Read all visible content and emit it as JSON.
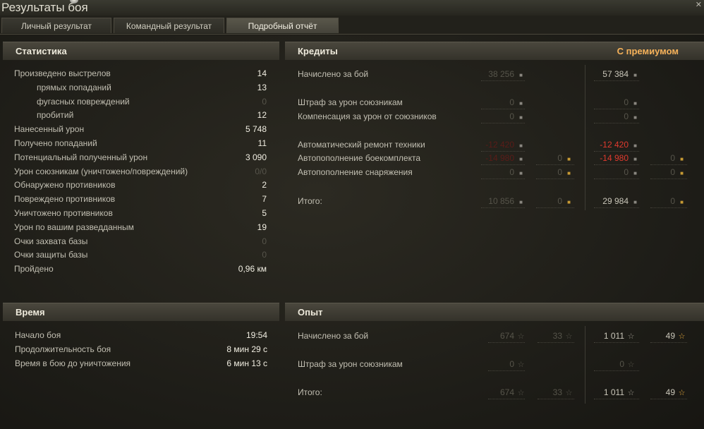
{
  "window": {
    "title": "Результаты боя",
    "close_glyph": "✕"
  },
  "tabs": [
    {
      "label": "Личный результат",
      "active": false
    },
    {
      "label": "Командный результат",
      "active": false
    },
    {
      "label": "Подробный отчёт",
      "active": true
    }
  ],
  "statistics": {
    "title": "Статистика",
    "rows": [
      {
        "label": "Произведено выстрелов",
        "value": "14",
        "sub": false,
        "dim": false
      },
      {
        "label": "прямых попаданий",
        "value": "13",
        "sub": true,
        "dim": false
      },
      {
        "label": "фугасных повреждений",
        "value": "0",
        "sub": true,
        "dim": true
      },
      {
        "label": "пробитий",
        "value": "12",
        "sub": true,
        "dim": false
      },
      {
        "label": "Нанесенный урон",
        "value": "5 748",
        "sub": false,
        "dim": false
      },
      {
        "label": "Получено попаданий",
        "value": "11",
        "sub": false,
        "dim": false
      },
      {
        "label": "Потенциальный полученный урон",
        "value": "3 090",
        "sub": false,
        "dim": false
      },
      {
        "label": "Урон союзникам (уничтожено/повреждений)",
        "value": "0/0",
        "sub": false,
        "dim": true
      },
      {
        "label": "Обнаружено противников",
        "value": "2",
        "sub": false,
        "dim": false
      },
      {
        "label": "Повреждено противников",
        "value": "7",
        "sub": false,
        "dim": false
      },
      {
        "label": "Уничтожено противников",
        "value": "5",
        "sub": false,
        "dim": false
      },
      {
        "label": "Урон по вашим разведданным",
        "value": "19",
        "sub": false,
        "dim": false
      },
      {
        "label": "Очки захвата базы",
        "value": "0",
        "sub": false,
        "dim": true
      },
      {
        "label": "Очки защиты базы",
        "value": "0",
        "sub": false,
        "dim": true
      },
      {
        "label": "Пройдено",
        "value": "0,96 км",
        "sub": false,
        "dim": false
      }
    ]
  },
  "credits": {
    "title": "Кредиты",
    "premium_label": "С премиумом",
    "rows": [
      {
        "label": "Начислено за бой",
        "base": "38 256",
        "base_gold": null,
        "prem": "57 384",
        "prem_gold": null,
        "base_red": false,
        "prem_red": false,
        "prem_dim": false
      },
      {
        "label": "Штраф за урон союзникам",
        "base": "0",
        "base_gold": null,
        "prem": "0",
        "prem_gold": null,
        "base_red": false,
        "prem_red": false,
        "prem_dim": true
      },
      {
        "label": "Компенсация за урон от союзников",
        "base": "0",
        "base_gold": null,
        "prem": "0",
        "prem_gold": null,
        "base_red": false,
        "prem_red": false,
        "prem_dim": true
      },
      {
        "label": "Автоматический ремонт техники",
        "base": "-12 420",
        "base_gold": null,
        "prem": "-12 420",
        "prem_gold": null,
        "base_red": true,
        "prem_red": true,
        "prem_dim": false
      },
      {
        "label": "Автопополнение боекомплекта",
        "base": "-14 980",
        "base_gold": "0",
        "prem": "-14 980",
        "prem_gold": "0",
        "base_red": true,
        "prem_red": true,
        "prem_dim": false
      },
      {
        "label": "Автопополнение снаряжения",
        "base": "0",
        "base_gold": "0",
        "prem": "0",
        "prem_gold": "0",
        "base_red": false,
        "prem_red": false,
        "prem_dim": true
      },
      {
        "label": "Итого:",
        "base": "10 856",
        "base_gold": "0",
        "prem": "29 984",
        "prem_gold": "0",
        "base_red": false,
        "prem_red": false,
        "prem_dim": false
      }
    ]
  },
  "time": {
    "title": "Время",
    "rows": [
      {
        "label": "Начало боя",
        "value": "19:54"
      },
      {
        "label": "Продолжительность боя",
        "value": "8 мин 29 с"
      },
      {
        "label": "Время в бою до уничтожения",
        "value": "6 мин 13 с"
      }
    ]
  },
  "experience": {
    "title": "Опыт",
    "rows": [
      {
        "label": "Начислено за бой",
        "base": "674",
        "base_free": "33",
        "prem": "1 011",
        "prem_free": "49",
        "prem_dim": false
      },
      {
        "label": "Штраф за урон союзникам",
        "base": "0",
        "base_free": null,
        "prem": "0",
        "prem_free": null,
        "prem_dim": true
      },
      {
        "label": "Итого:",
        "base": "674",
        "base_free": "33",
        "prem": "1 011",
        "prem_free": "49",
        "prem_dim": false
      }
    ]
  },
  "icons": {
    "credit": "credit-coin-icon",
    "gold": "gold-coin-icon",
    "xp": "star-icon",
    "free_xp": "gold-star-icon"
  },
  "colors": {
    "premium_header": "#f6b25a",
    "negative": "#e03a2e",
    "gold_icon": "#c79a34"
  }
}
